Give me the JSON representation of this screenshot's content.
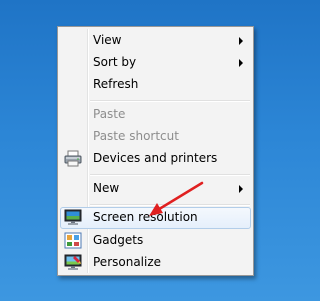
{
  "context_menu": {
    "items": [
      {
        "label": "View",
        "submenu": true
      },
      {
        "label": "Sort by",
        "submenu": true
      },
      {
        "label": "Refresh"
      },
      {
        "label": "Paste",
        "disabled": true
      },
      {
        "label": "Paste shortcut",
        "disabled": true
      },
      {
        "label": "Devices and printers",
        "icon": "printer-icon"
      },
      {
        "label": "New",
        "submenu": true
      },
      {
        "label": "Screen resolution",
        "icon": "monitor-icon",
        "highlighted": true
      },
      {
        "label": "Gadgets",
        "icon": "gadgets-icon"
      },
      {
        "label": "Personalize",
        "icon": "personalize-icon"
      }
    ]
  },
  "annotation": {
    "color": "#e02020",
    "target": "Screen resolution"
  },
  "colors": {
    "desktop": "#2a82d4",
    "menu_bg": "#f3f3f3",
    "highlight_border": "#b2cde9"
  }
}
